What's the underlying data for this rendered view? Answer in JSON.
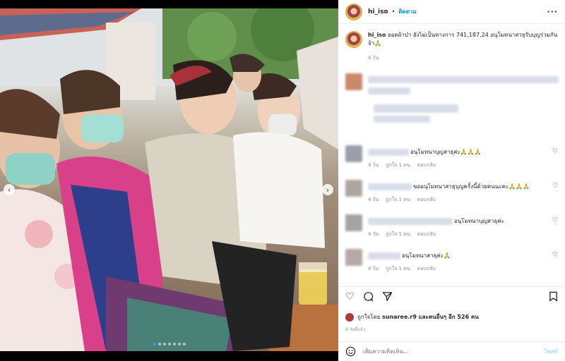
{
  "post": {
    "username": "hi_iso",
    "separator": "•",
    "follow_label": "ติดตาม",
    "more_label": "···",
    "caption_username": "hi_iso",
    "caption_text": "ยอดผ้าป่า ยังไม่เป็นทางการ 741,187,24 อนุโมทนาสาธุรับบุญร่วมกันจ้า🙏",
    "caption_time": "4 วัน"
  },
  "comments": [
    {
      "text": "อนุโมทนาบุญสาธุค่ะ🙏🙏🙏",
      "time": "4 วัน",
      "likes": "ถูกใจ 1 คน",
      "reply": "ตอบกลับ"
    },
    {
      "text": "ขออนุโมทนาสาธุบุญครั้งนี้ด้วยคนนะคะ🙏🙏🙏",
      "time": "4 วัน",
      "likes": "ถูกใจ 1 คน",
      "reply": "ตอบกลับ"
    },
    {
      "text": "อนุโมทนาบุญสาธุค่ะ",
      "time": "4 วัน",
      "likes": "ถูกใจ 1 คน",
      "reply": "ตอบกลับ"
    },
    {
      "text": "อนุโมทนาสาธุค่ะ🙏",
      "time": "4 วัน",
      "likes": "ถูกใจ 1 คน",
      "reply": "ตอบกลับ"
    }
  ],
  "likes": {
    "prefix": "ถูกใจโดย",
    "user": "sunaree.r9",
    "suffix": "และคนอื่นๆ อีก 526 คน"
  },
  "post_time": "4 วันที่แล้ว",
  "add_comment": {
    "placeholder": "เพิ่มความคิดเห็น...",
    "post_label": "โพสต์"
  },
  "icons": {
    "heart": "heart-icon",
    "comment": "comment-icon",
    "share": "share-icon",
    "bookmark": "bookmark-icon",
    "emoji": "emoji-icon"
  },
  "colors": {
    "follow": "#0095f6",
    "post_disabled": "#b2dffc",
    "carousel_active": "#3897f0"
  },
  "carousel": {
    "total": 7,
    "active": 1
  }
}
